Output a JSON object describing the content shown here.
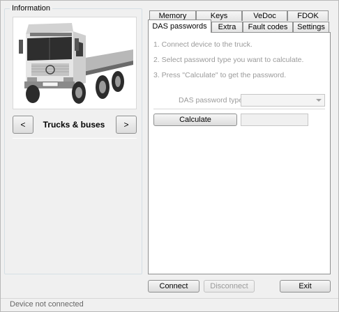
{
  "group": {
    "title": "Information"
  },
  "vehicle": {
    "caption": "Trucks & buses",
    "prev_label": "<",
    "next_label": ">"
  },
  "tabs": {
    "row_back": [
      "Memory",
      "Keys",
      "VeDoc",
      "FDOK"
    ],
    "row_front": [
      "DAS passwords",
      "Extra",
      "Fault codes",
      "Settings"
    ],
    "active": "DAS passwords"
  },
  "das": {
    "steps": [
      "1. Connect device to the truck.",
      "2. Select password type you want to calculate.",
      "3. Press \"Calculate\" to get the password."
    ],
    "password_type_label": "DAS password type",
    "password_type_value": "",
    "calculate_label": "Calculate",
    "result_value": ""
  },
  "actions": {
    "connect": "Connect",
    "disconnect": "Disconnect",
    "exit": "Exit"
  },
  "status": {
    "text": "Device not connected"
  }
}
